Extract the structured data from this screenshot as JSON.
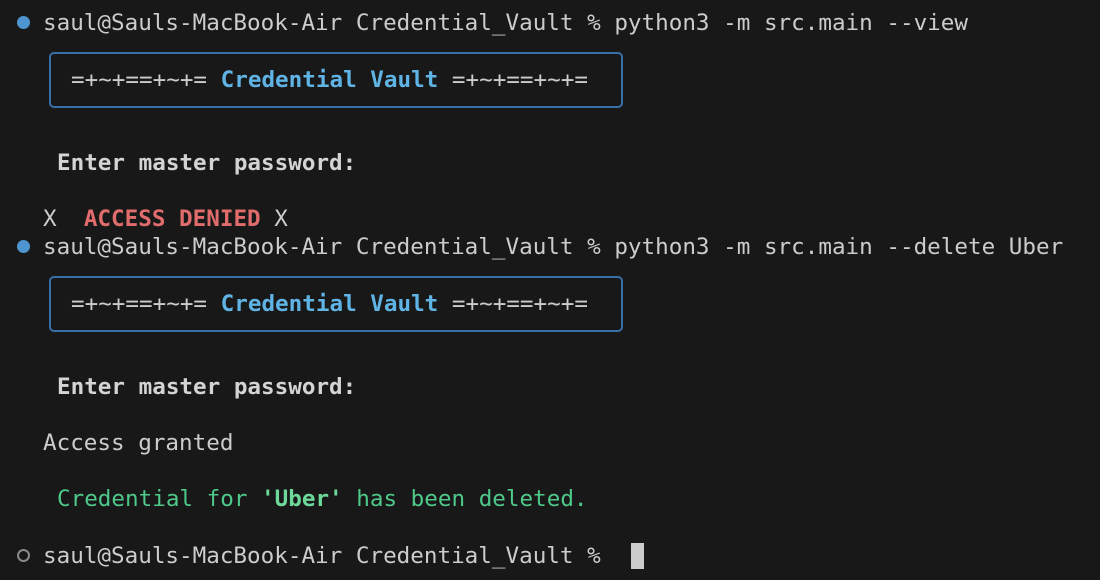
{
  "session1": {
    "prompt": "saul@Sauls-MacBook-Air Credential_Vault % ",
    "command": "python3 -m src.main --view",
    "banner_deco_left": "=+~+==+~+= ",
    "banner_title": "Credential Vault",
    "banner_deco_right": " =+~+==+~+=",
    "password_prompt": "Enter master password:",
    "denied_prefix": "X  ",
    "denied_text": "ACCESS DENIED",
    "denied_suffix": " X"
  },
  "session2": {
    "prompt": "saul@Sauls-MacBook-Air Credential_Vault % ",
    "command": "python3 -m src.main --delete Uber",
    "banner_deco_left": "=+~+==+~+= ",
    "banner_title": "Credential Vault",
    "banner_deco_right": " =+~+==+~+=",
    "password_prompt": "Enter master password:",
    "granted_text": "Access granted",
    "deleted_prefix": "Credential for ",
    "deleted_name": "'Uber'",
    "deleted_suffix": " has been deleted."
  },
  "current": {
    "prompt": "saul@Sauls-MacBook-Air Credential_Vault % "
  },
  "colors": {
    "background": "#181818",
    "text": "#cccccc",
    "accent_title": "#5fb4e5",
    "error": "#e06c6c",
    "success": "#4ec98a",
    "banner_border": "#3a6ea8"
  }
}
